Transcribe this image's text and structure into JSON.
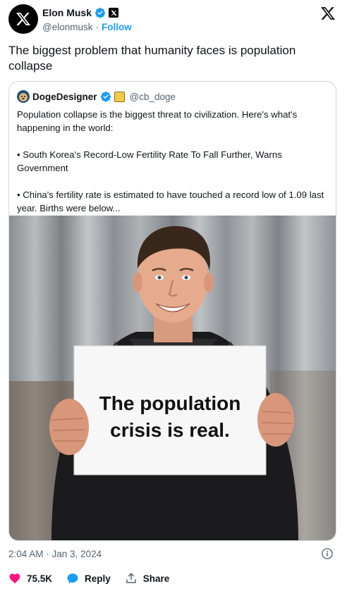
{
  "author": {
    "name": "Elon Musk",
    "handle": "@elonmusk",
    "separator": "·",
    "follow_label": "Follow"
  },
  "tweet": {
    "text": "The biggest problem that humanity faces is population collapse"
  },
  "quote": {
    "name": "DogeDesigner",
    "handle": "@cb_doge",
    "lines": [
      "Population collapse is the biggest threat to civilization. Here's what's happening in the world:",
      "• South Korea's Record-Low Fertility Rate To Fall Further, Warns Government",
      "• China's fertility rate is estimated to have touched a record low of 1.09 last year. Births were below..."
    ],
    "image": {
      "sign_line1": "The population",
      "sign_line2": "crisis is real."
    }
  },
  "footer": {
    "timestamp": "2:04 AM · Jan 3, 2024",
    "likes": "75.5K",
    "reply_label": "Reply",
    "share_label": "Share"
  },
  "colors": {
    "accent": "#1d9bf0",
    "like": "#f91880",
    "text_secondary": "#536471",
    "border": "#cfd9de"
  },
  "icons": [
    "x-avatar-icon",
    "verified-icon",
    "x-affiliate-icon",
    "x-logo-icon",
    "doge-avatar-icon",
    "info-icon",
    "heart-icon",
    "reply-icon",
    "share-icon"
  ]
}
